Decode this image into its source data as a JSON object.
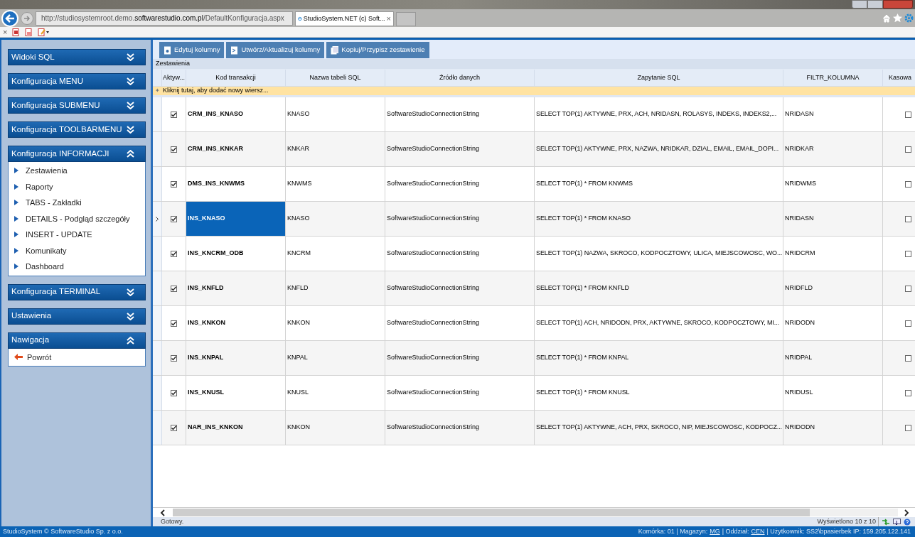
{
  "browser": {
    "address_prefix": "http://studiosystemroot.demo.",
    "address_domain": "softwarestudio.com.pl",
    "address_suffix": "/DefaultKonfiguracja.aspx",
    "tab_title": "StudioSystem.NET (c) Soft...",
    "tab_close": "×",
    "stop": "×"
  },
  "sidebar": {
    "panels": [
      {
        "title": "Widoki SQL",
        "expanded": false
      },
      {
        "title": "Konfiguracja MENU",
        "expanded": false
      },
      {
        "title": "Konfiguracja SUBMENU",
        "expanded": false
      },
      {
        "title": "Konfiguracja TOOLBARMENU",
        "expanded": false
      },
      {
        "title": "Konfiguracja INFORMACJI",
        "expanded": true,
        "items": [
          {
            "label": "Zestawienia",
            "kind": "bullet"
          },
          {
            "label": "Raporty",
            "kind": "bullet"
          },
          {
            "label": "TABS - Zakładki",
            "kind": "bullet"
          },
          {
            "label": "DETAILS - Podgląd szczegóły",
            "kind": "bullet"
          },
          {
            "label": "INSERT - UPDATE",
            "kind": "bullet"
          },
          {
            "label": "Komunikaty",
            "kind": "bullet"
          },
          {
            "label": "Dashboard",
            "kind": "bullet"
          }
        ]
      },
      {
        "title": "Konfiguracja TERMINAL",
        "expanded": false
      },
      {
        "title": "Ustawienia",
        "expanded": false
      },
      {
        "title": "Nawigacja",
        "expanded": true,
        "items": [
          {
            "label": "Powrót",
            "kind": "back"
          }
        ]
      }
    ]
  },
  "toolbar": [
    "Edytuj kolumny",
    "Utwórz/Aktualizuj kolumny",
    "Kopiuj/Przypisz zestawienie"
  ],
  "grid": {
    "caption": "Zestawienia",
    "columns": [
      "Aktyw...",
      "Kod transakcji",
      "Nazwa tabeli SQL",
      "Źródło danych",
      "Zapytanie SQL",
      "FILTR_KOLUMNA",
      "Kasowa"
    ],
    "add_row_icon": "✦",
    "add_row": "Kliknij tutaj, aby dodać nowy wiersz...",
    "rows": [
      {
        "selected": false,
        "active": true,
        "code": "CRM_INS_KNASO",
        "table": "KNASO",
        "source": "SoftwareStudioConnectionString",
        "query": "SELECT TOP(1) AKTYWNE, PRX, ACH, NRIDASN, ROLASYS, INDEKS, INDEKS2,...",
        "filter": "NRIDASN",
        "delete": false
      },
      {
        "selected": false,
        "active": true,
        "code": "CRM_INS_KNKAR",
        "table": "KNKAR",
        "source": "SoftwareStudioConnectionString",
        "query": "SELECT TOP(1) AKTYWNE, PRX, NAZWA, NRIDKAR, DZIAL, EMAIL, EMAIL_DOPI...",
        "filter": "NRIDKAR",
        "delete": false
      },
      {
        "selected": false,
        "active": true,
        "code": "DMS_INS_KNWMS",
        "table": "KNWMS",
        "source": "SoftwareStudioConnectionString",
        "query": "SELECT TOP(1) * FROM KNWMS",
        "filter": "NRIDWMS",
        "delete": false
      },
      {
        "selected": true,
        "active": true,
        "code": "INS_KNASO",
        "table": "KNASO",
        "source": "SoftwareStudioConnectionString",
        "query": "SELECT TOP(1) * FROM KNASO",
        "filter": "NRIDASN",
        "delete": false
      },
      {
        "selected": false,
        "active": true,
        "code": "INS_KNCRM_ODB",
        "table": "KNCRM",
        "source": "SoftwareStudioConnectionString",
        "query": "SELECT TOP(1) NAZWA, SKROCO, KODPOCZTOWY, ULICA, MIEJSCOWOSC, WO...",
        "filter": "NRIDCRM",
        "delete": false
      },
      {
        "selected": false,
        "active": true,
        "code": "INS_KNFLD",
        "table": "KNFLD",
        "source": "SoftwareStudioConnectionString",
        "query": "SELECT TOP(1) * FROM KNFLD",
        "filter": "NRIDFLD",
        "delete": false
      },
      {
        "selected": false,
        "active": true,
        "code": "INS_KNKON",
        "table": "KNKON",
        "source": "SoftwareStudioConnectionString",
        "query": "SELECT TOP(1) ACH, NRIDODN, PRX, AKTYWNE, SKROCO, KODPOCZTOWY, MI...",
        "filter": "NRIDODN",
        "delete": false
      },
      {
        "selected": false,
        "active": true,
        "code": "INS_KNPAL",
        "table": "KNPAL",
        "source": "SoftwareStudioConnectionString",
        "query": "SELECT TOP(1) * FROM KNPAL",
        "filter": "NRIDPAL",
        "delete": false
      },
      {
        "selected": false,
        "active": true,
        "code": "INS_KNUSL",
        "table": "KNUSL",
        "source": "SoftwareStudioConnectionString",
        "query": "SELECT TOP(1) * FROM KNUSL",
        "filter": "NRIDUSL",
        "delete": false
      },
      {
        "selected": false,
        "active": true,
        "code": "NAR_INS_KNKON",
        "table": "KNKON",
        "source": "SoftwareStudioConnectionString",
        "query": "SELECT TOP(1) AKTYWNE, ACH, PRX, SKROCO, NIP, MIEJSCOWOSC, KODPOCZ...",
        "filter": "NRIDODN",
        "delete": false
      }
    ],
    "pager": "Wyświetlono 10 z 10"
  },
  "status": "Gotowy.",
  "footer": {
    "copyright": "StudioSystem © SoftwareStudio Sp. z o.o.",
    "info": [
      {
        "kind": "text",
        "text": "Komórka: 01 | Magazyn:"
      },
      {
        "kind": "link",
        "text": "MG"
      },
      {
        "kind": "text",
        "text": "| Oddział:"
      },
      {
        "kind": "link",
        "text": "CEN"
      },
      {
        "kind": "text",
        "text": "| Użytkownik: SS2\\bpasierbek IP: 159.205.122.141"
      }
    ]
  }
}
